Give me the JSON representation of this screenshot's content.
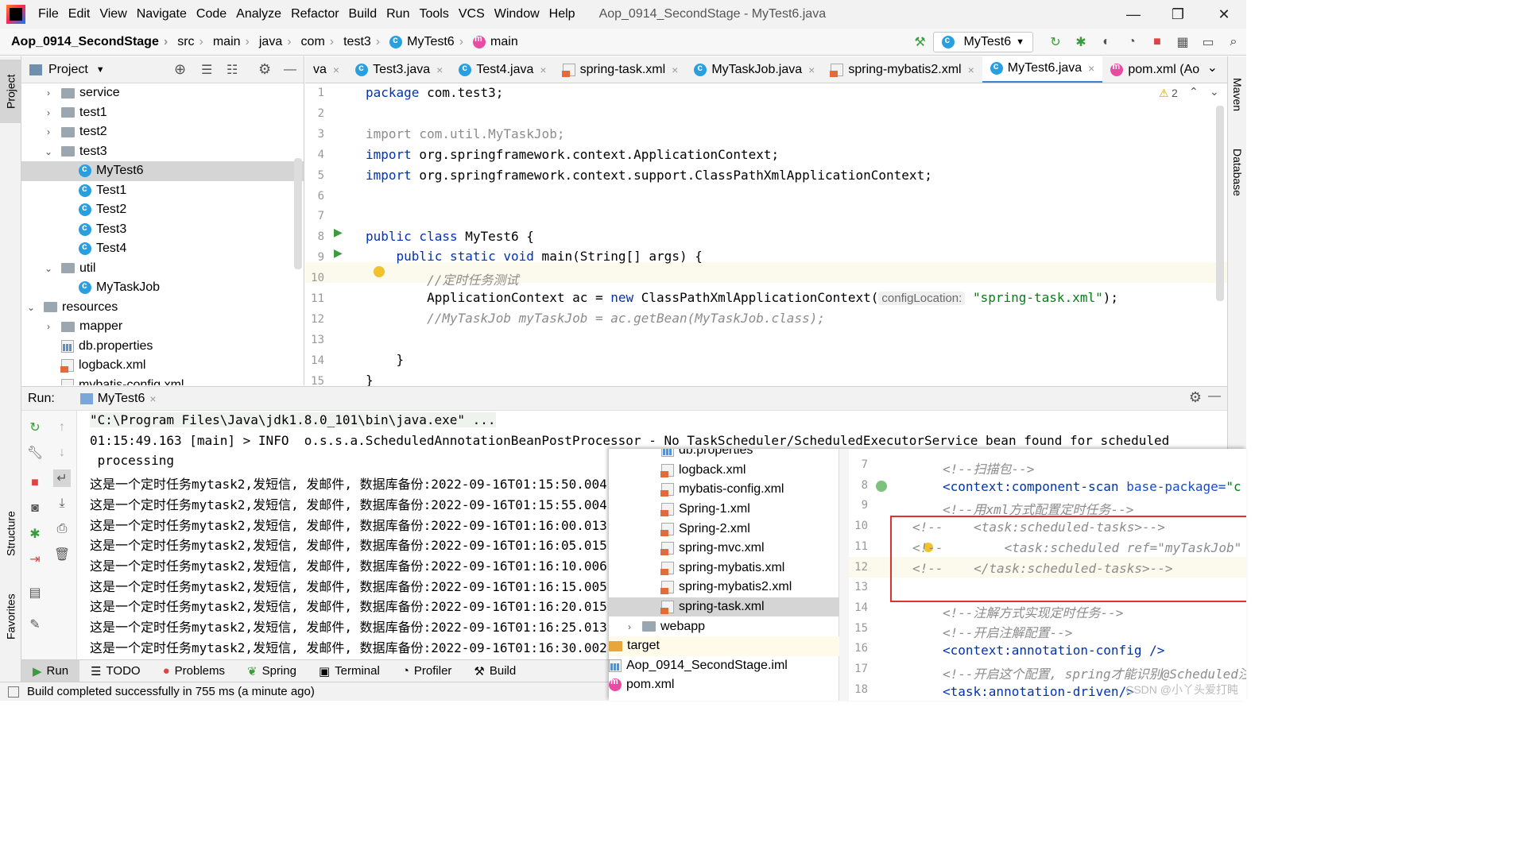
{
  "menubar": {
    "items": [
      "File",
      "Edit",
      "View",
      "Navigate",
      "Code",
      "Analyze",
      "Refactor",
      "Build",
      "Run",
      "Tools",
      "VCS",
      "Window",
      "Help"
    ],
    "title": "Aop_0914_SecondStage - MyTest6.java",
    "minimize": "—",
    "restore": "❐",
    "close": "✕"
  },
  "navbar": {
    "crumbs": [
      "Aop_0914_SecondStage",
      "src",
      "main",
      "java",
      "com",
      "test3",
      "MyTest6",
      "main"
    ],
    "run_config": "MyTest6"
  },
  "sidestrips": {
    "project": "Project",
    "structure": "Structure",
    "favorites": "Favorites",
    "maven": "Maven",
    "database": "Database"
  },
  "project": {
    "header": "Project",
    "tree": [
      {
        "label": "service",
        "type": "folder",
        "indent": 3,
        "arrow": "›"
      },
      {
        "label": "test1",
        "type": "folder",
        "indent": 3,
        "arrow": "›"
      },
      {
        "label": "test2",
        "type": "folder",
        "indent": 3,
        "arrow": "›"
      },
      {
        "label": "test3",
        "type": "folder",
        "indent": 3,
        "arrow": "⌄"
      },
      {
        "label": "MyTest6",
        "type": "class",
        "indent": 4,
        "arrow": "",
        "selected": true
      },
      {
        "label": "Test1",
        "type": "class",
        "indent": 4,
        "arrow": ""
      },
      {
        "label": "Test2",
        "type": "class",
        "indent": 4,
        "arrow": ""
      },
      {
        "label": "Test3",
        "type": "class",
        "indent": 4,
        "arrow": ""
      },
      {
        "label": "Test4",
        "type": "class",
        "indent": 4,
        "arrow": ""
      },
      {
        "label": "util",
        "type": "folder",
        "indent": 3,
        "arrow": "⌄"
      },
      {
        "label": "MyTaskJob",
        "type": "class",
        "indent": 4,
        "arrow": ""
      },
      {
        "label": "resources",
        "type": "folder",
        "indent": 2,
        "arrow": "⌄"
      },
      {
        "label": "mapper",
        "type": "folder",
        "indent": 3,
        "arrow": "›"
      },
      {
        "label": "db.properties",
        "type": "props",
        "indent": 3,
        "arrow": ""
      },
      {
        "label": "logback.xml",
        "type": "xml",
        "indent": 3,
        "arrow": ""
      },
      {
        "label": "mybatis-config.xml",
        "type": "xml",
        "indent": 3,
        "arrow": ""
      }
    ]
  },
  "editor": {
    "tabs": [
      {
        "label": "va",
        "icon": "none"
      },
      {
        "label": "Test3.java",
        "icon": "class"
      },
      {
        "label": "Test4.java",
        "icon": "class"
      },
      {
        "label": "spring-task.xml",
        "icon": "xml"
      },
      {
        "label": "MyTaskJob.java",
        "icon": "class"
      },
      {
        "label": "spring-mybatis2.xml",
        "icon": "xml"
      },
      {
        "label": "MyTest6.java",
        "icon": "class",
        "active": true
      },
      {
        "label": "pom.xml (Ao",
        "icon": "maven"
      }
    ],
    "warnings": "2",
    "line_numbers": [
      "1",
      "2",
      "3",
      "4",
      "5",
      "6",
      "7",
      "8",
      "9",
      "10",
      "11",
      "12",
      "13",
      "14",
      "15"
    ],
    "code": {
      "l1_kw": "package",
      "l1_rest": " com.test3;",
      "l3": "import com.util.MyTaskJob;",
      "l4_kw": "import",
      "l4_rest": " org.springframework.context.ApplicationContext;",
      "l5_kw": "import",
      "l5_rest": " org.springframework.context.support.ClassPathXmlApplicationContext;",
      "l8_kw": "public class",
      "l8_rest": " MyTest6 {",
      "l9_kw": "    public static void",
      "l9_rest": " main(String[] args) {",
      "l10": "        //定时任务测试",
      "l11_a": "        ApplicationContext ac = ",
      "l11_kw": "new",
      "l11_b": " ClassPathXmlApplicationContext(",
      "l11_hint": "configLocation:",
      "l11_str": "\"spring-task.xml\"",
      "l11_c": ");",
      "l12": "        //MyTaskJob myTaskJob = ac.getBean(MyTaskJob.class);",
      "l14": "    }",
      "l15": "}"
    }
  },
  "run": {
    "label": "Run:",
    "tab": "MyTest6",
    "lines": [
      "\"C:\\Program Files\\Java\\jdk1.8.0_101\\bin\\java.exe\" ...",
      "01:15:49.163 [main] > INFO  o.s.s.a.ScheduledAnnotationBeanPostProcessor - No TaskScheduler/ScheduledExecutorService bean found for scheduled",
      " processing",
      "这是一个定时任务mytask2,发短信, 发邮件, 数据库备份:2022-09-16T01:15:50.004",
      "这是一个定时任务mytask2,发短信, 发邮件, 数据库备份:2022-09-16T01:15:55.004",
      "这是一个定时任务mytask2,发短信, 发邮件, 数据库备份:2022-09-16T01:16:00.013",
      "这是一个定时任务mytask2,发短信, 发邮件, 数据库备份:2022-09-16T01:16:05.015",
      "这是一个定时任务mytask2,发短信, 发邮件, 数据库备份:2022-09-16T01:16:10.006",
      "这是一个定时任务mytask2,发短信, 发邮件, 数据库备份:2022-09-16T01:16:15.005",
      "这是一个定时任务mytask2,发短信, 发邮件, 数据库备份:2022-09-16T01:16:20.015",
      "这是一个定时任务mytask2,发短信, 发邮件, 数据库备份:2022-09-16T01:16:25.013",
      "这是一个定时任务mytask2,发短信, 发邮件, 数据库备份:2022-09-16T01:16:30.002"
    ]
  },
  "bottom_tabs": [
    "Run",
    "TODO",
    "Problems",
    "Spring",
    "Terminal",
    "Profiler",
    "Build"
  ],
  "status": "Build completed successfully in 755 ms (a minute ago)",
  "overlay": {
    "tree": [
      {
        "label": "db.properties",
        "type": "props"
      },
      {
        "label": "logback.xml",
        "type": "xml"
      },
      {
        "label": "mybatis-config.xml",
        "type": "xml"
      },
      {
        "label": "Spring-1.xml",
        "type": "xml"
      },
      {
        "label": "Spring-2.xml",
        "type": "xml"
      },
      {
        "label": "spring-mvc.xml",
        "type": "xml"
      },
      {
        "label": "spring-mybatis.xml",
        "type": "xml"
      },
      {
        "label": "spring-mybatis2.xml",
        "type": "xml"
      },
      {
        "label": "spring-task.xml",
        "type": "xml",
        "selected": true
      },
      {
        "label": "webapp",
        "type": "folder"
      },
      {
        "label": "target",
        "type": "orangefolder"
      },
      {
        "label": "Aop_0914_SecondStage.iml",
        "type": "iml"
      },
      {
        "label": "pom.xml",
        "type": "maven"
      }
    ],
    "line_numbers": [
      "7",
      "8",
      "9",
      "10",
      "11",
      "12",
      "13",
      "14",
      "15",
      "16",
      "17",
      "18"
    ],
    "code": {
      "l7": "<!--扫描包-->",
      "l8_tag": "<context:component-scan",
      "l8_attr": " base-package=",
      "l8_val": "\"c",
      "l9": "<!--用xml方式配置定时任务-->",
      "l10": "<!--    <task:scheduled-tasks>-->",
      "l11": "<!--        <task:scheduled ref=\"myTaskJob\"",
      "l12": "<!--    </task:scheduled-tasks>-->",
      "l14": "<!--注解方式实现定时任务-->",
      "l15": "<!--开启注解配置-->",
      "l16_tag": "<context:annotation-config",
      "l16_end": " />",
      "l17": "<!--开启这个配置, spring才能识别@Scheduled注",
      "l18_tag": "<task:annotation-driven",
      "l18_end": "/>"
    },
    "watermark": "CSDN @小丫头爱打盹"
  }
}
